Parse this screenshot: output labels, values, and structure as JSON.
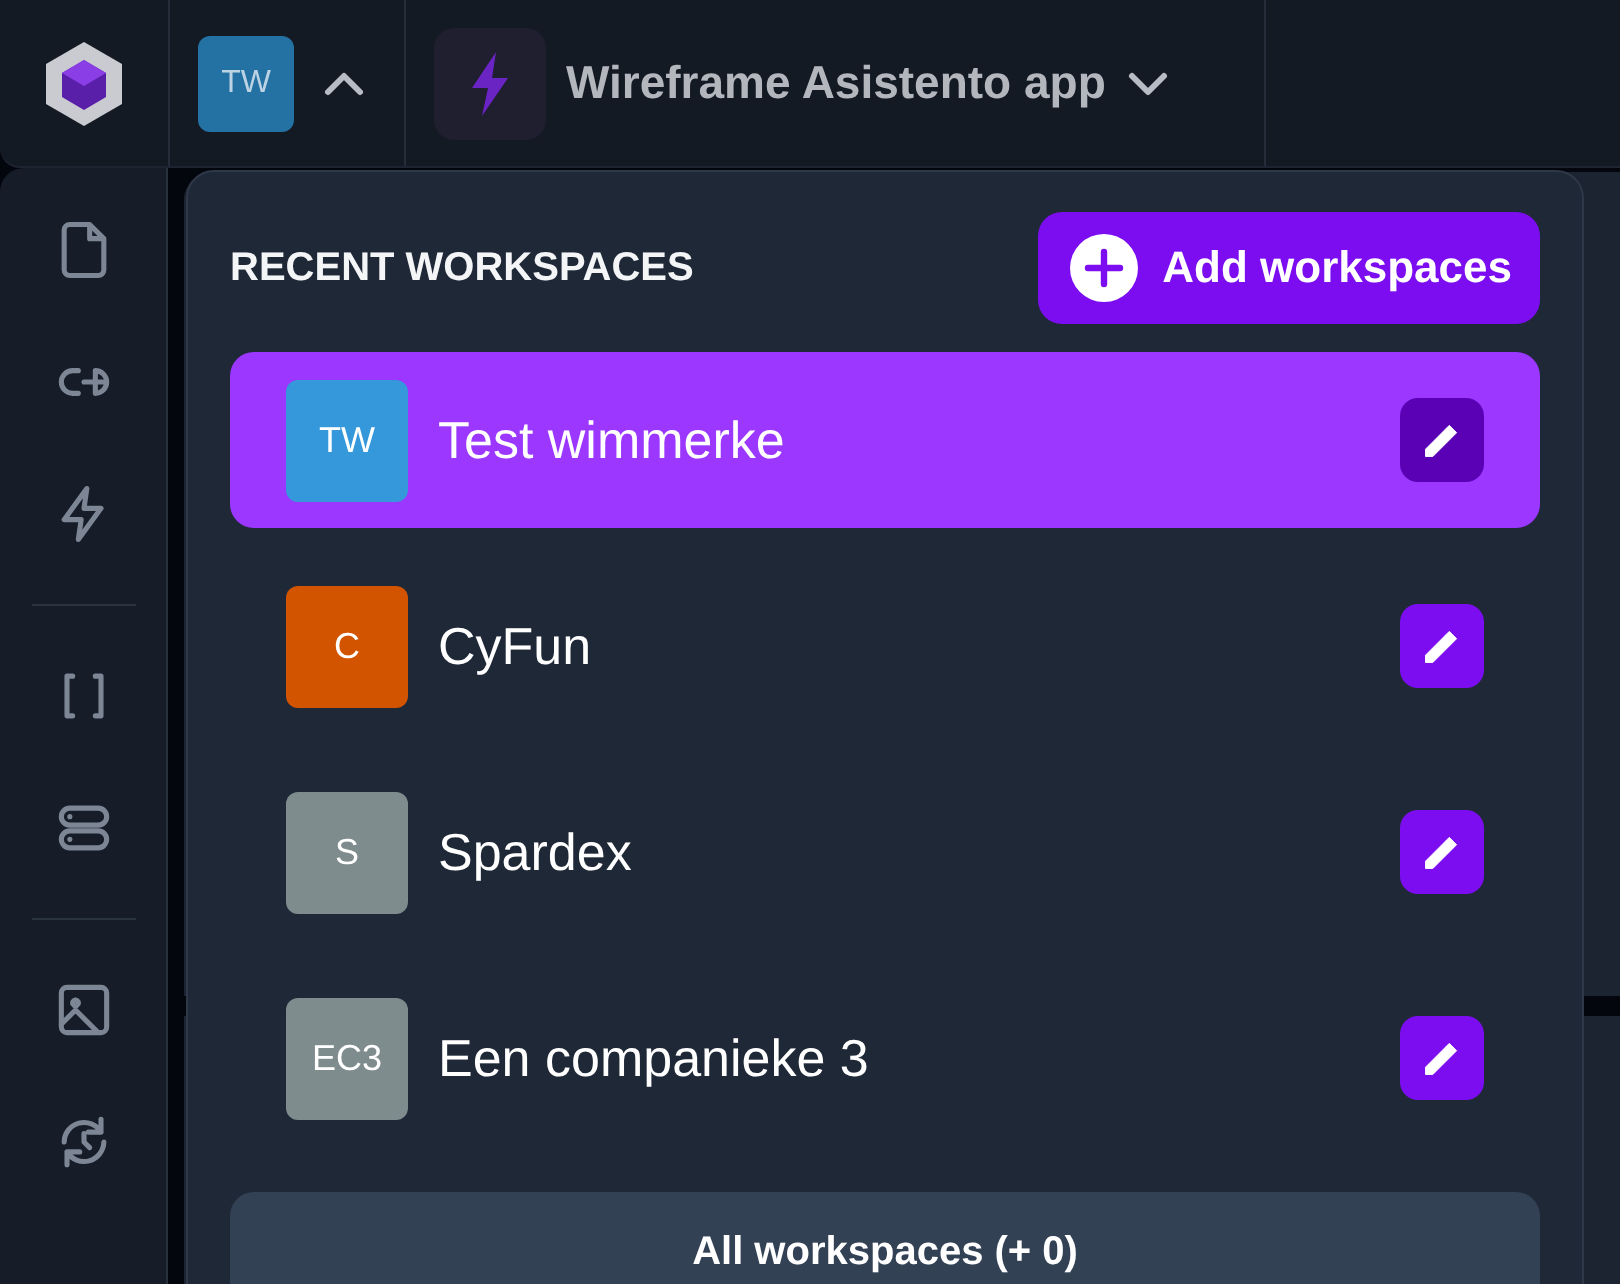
{
  "topbar": {
    "workspace_initials": "TW",
    "workspace_menu_expanded": true,
    "app_name": "Wireframe Asistento app"
  },
  "dropdown": {
    "title": "RECENT WORKSPACES",
    "add_button": "Add workspaces",
    "workspaces": [
      {
        "initials": "TW",
        "name": "Test wimmerke",
        "color": "#3498db",
        "selected": true
      },
      {
        "initials": "C",
        "name": "CyFun",
        "color": "#d35400",
        "selected": false
      },
      {
        "initials": "S",
        "name": "Spardex",
        "color": "#7f8c8d",
        "selected": false
      },
      {
        "initials": "EC3",
        "name": "Een companieke 3",
        "color": "#7f8c8d",
        "selected": false
      }
    ],
    "all_button": "All workspaces (+ 0)"
  }
}
